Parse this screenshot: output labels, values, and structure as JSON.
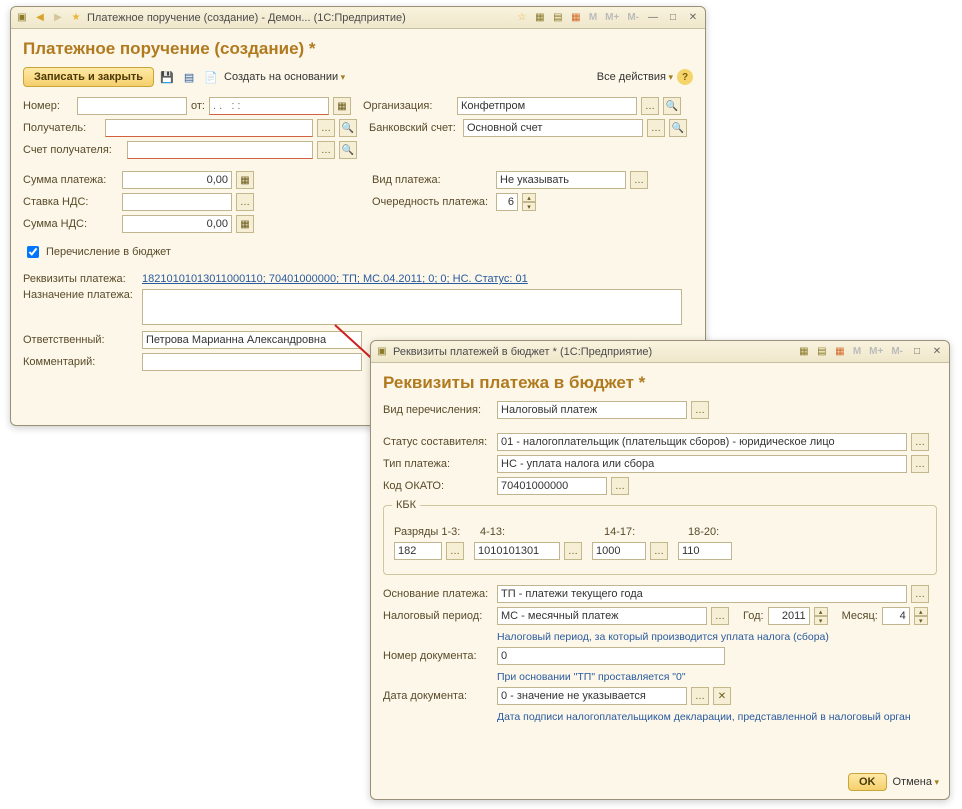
{
  "win1": {
    "title": "Платежное поручение (создание) - Демон...  (1С:Предприятие)",
    "heading": "Платежное поручение (создание) *",
    "toolbar": {
      "save_close": "Записать и закрыть",
      "create_based": "Создать на основании",
      "all_actions": "Все действия"
    },
    "labels": {
      "number": "Номер:",
      "ot": "от:",
      "date_placeholder": ". .   : :",
      "org": "Организация:",
      "recipient": "Получатель:",
      "bank_acc": "Банковский счет:",
      "recipient_acc": "Счет получателя:",
      "sum": "Сумма платежа:",
      "vid": "Вид платежа:",
      "stavka": "Ставка НДС:",
      "ochered": "Очередность платежа:",
      "sum_nds": "Сумма НДС:",
      "to_budget": "Перечисление в бюджет",
      "rekv": "Реквизиты платежа:",
      "nazn": "Назначение платежа:",
      "resp": "Ответственный:",
      "comment": "Комментарий:"
    },
    "values": {
      "org": "Конфетпром",
      "bank_acc": "Основной счет",
      "sum": "0,00",
      "sum_nds": "0,00",
      "vid": "Не указывать",
      "ochered": "6",
      "rekv_link": "18210101013011000110; 70401000000; ТП; МС.04.2011; 0; 0; НС. Статус: 01",
      "resp": "Петрова Марианна Александровна"
    }
  },
  "win2": {
    "title": "Реквизиты платежей в бюджет *   (1С:Предприятие)",
    "heading": "Реквизиты платежа в бюджет *",
    "labels": {
      "vid_per": "Вид перечисления:",
      "status": "Статус составителя:",
      "tip": "Тип платежа:",
      "okato": "Код ОКАТО:",
      "kbk": "КБК",
      "r13": "Разряды 1-3:",
      "r413": "4-13:",
      "r1417": "14-17:",
      "r1820": "18-20:",
      "osn": "Основание платежа:",
      "nal_period": "Налоговый период:",
      "god": "Год:",
      "mes": "Месяц:",
      "period_hint": "Налоговый период, за который производится уплата налога (сбора)",
      "doc_num": "Номер документа:",
      "doc_num_hint": "При основании \"ТП\" проставляется \"0\"",
      "doc_date": "Дата документа:",
      "doc_date_hint": "Дата подписи налогоплательщиком декларации, представленной в налоговый орган",
      "ok": "OK",
      "cancel": "Отмена"
    },
    "values": {
      "vid_per": "Налоговый платеж",
      "status": "01 - налогоплательщик (плательщик сборов) - юридическое лицо",
      "tip": "НС - уплата налога или сбора",
      "okato": "70401000000",
      "r13": "182",
      "r413": "1010101301",
      "r1417": "1000",
      "r1820": "110",
      "osn": "ТП - платежи текущего года",
      "nal_period": "МС - месячный платеж",
      "god": "2011",
      "mes": "4",
      "doc_num": "0",
      "doc_date": "0 - значение не указывается"
    }
  }
}
